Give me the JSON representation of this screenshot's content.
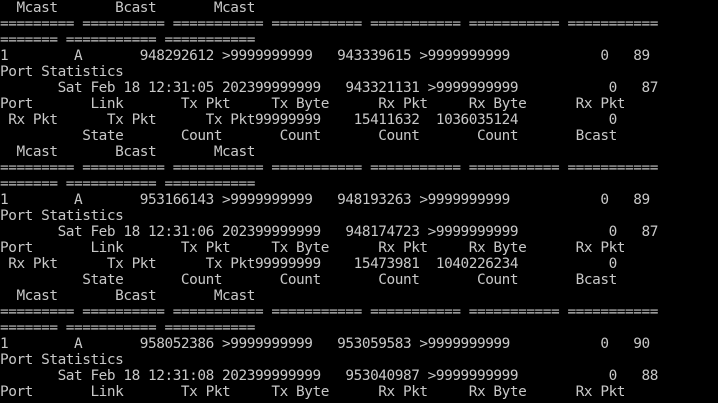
{
  "terminal": {
    "lines": [
      "  Mcast       Bcast       Mcast",
      "========= ========== =========== =========== =========== =========== ===========",
      "======= =========== ===========",
      "1        A       948292612 >9999999999   943339615 >9999999999           0   89",
      "Port Statistics",
      "       Sat Feb 18 12:31:05 202399999999   943321131 >9999999999           0   87",
      "Port       Link       Tx Pkt     Tx Byte      Rx Pkt     Rx Byte      Rx Pkt",
      " Rx Pkt      Tx Pkt      Tx Pkt99999999    15411632  1036035124           0",
      "          State       Count       Count       Count       Count       Bcast",
      "  Mcast       Bcast       Mcast",
      "========= ========== =========== =========== =========== =========== ===========",
      "======= =========== ===========",
      "1        A       953166143 >9999999999   948193263 >9999999999           0   89",
      "Port Statistics",
      "       Sat Feb 18 12:31:06 202399999999   948174723 >9999999999           0   87",
      "Port       Link       Tx Pkt     Tx Byte      Rx Pkt     Rx Byte      Rx Pkt",
      " Rx Pkt      Tx Pkt      Tx Pkt99999999    15473981  1040226234           0",
      "          State       Count       Count       Count       Count       Bcast",
      "  Mcast       Bcast       Mcast",
      "========= ========== =========== =========== =========== =========== ===========",
      "======= =========== ===========",
      "1        A       958052386 >9999999999   953059583 >9999999999           0   90",
      "Port Statistics",
      "       Sat Feb 18 12:31:08 202399999999   953040987 >9999999999           0   88",
      "Port       Link       Tx Pkt     Tx Byte      Rx Pkt     Rx Byte      Rx Pkt"
    ]
  }
}
